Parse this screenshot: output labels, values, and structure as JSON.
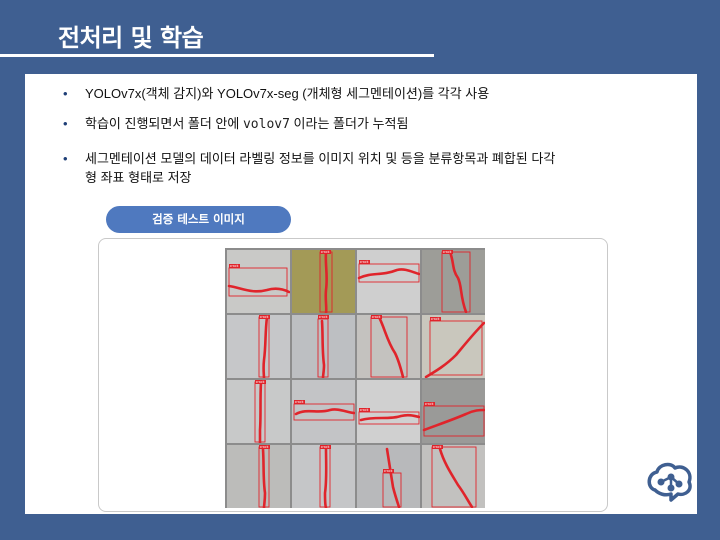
{
  "slide": {
    "title": "전처리 및 학습",
    "bullets": {
      "b1": "YOLOv7x(객체 감지)와 YOLOv7x-seg (개체형 세그멘테이션)를 각각 사용",
      "b2_pre": "학습이 진행되면서 폴더 안에 ",
      "b2_code": "volov7",
      "b2_post": " 이라는 폴더가 누적됨",
      "b3_line1": "세그멘테이션 모델의 데이터 라벨링 정보를 이미지 위치 및 등을 분류항목과 폐합된 다각",
      "b3_line2": "형 좌표 형태로 저장"
    },
    "image_caption": "검증 테스트 이미지",
    "bullet_glyph": "•"
  },
  "colors": {
    "background": "#3f5f91",
    "pill": "#4f79bf",
    "bullet": "#1f3f77",
    "mask": "#e0242b",
    "logo": "#3f5f91"
  },
  "icons": {
    "logo": "brain-network-logo"
  },
  "grid_images": {
    "count": 16,
    "rows": 4,
    "columns": 4,
    "label": "crack"
  }
}
